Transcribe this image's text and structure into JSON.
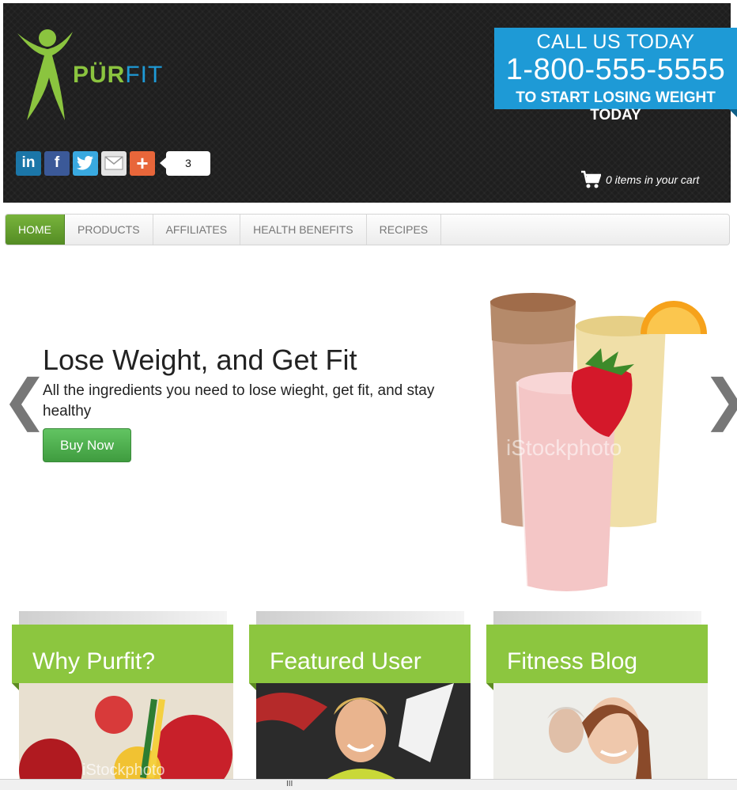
{
  "brand": {
    "pur": "PÜR",
    "fit": "FIT",
    "green": "#8bc43f",
    "blue": "#1e9ad6"
  },
  "callout": {
    "line1": "CALL US TODAY",
    "phone": "1-800-555-5555",
    "line3": "TO START LOSING WEIGHT TODAY"
  },
  "social": {
    "icons": [
      "linkedin-icon",
      "facebook-icon",
      "twitter-icon",
      "email-icon",
      "addthis-plus-icon"
    ],
    "linkedin": "in",
    "facebook": "f",
    "twitter": "t",
    "plus": "+",
    "share_count": "3"
  },
  "cart": {
    "text": "0 items in your cart"
  },
  "nav": {
    "items": [
      "HOME",
      "PRODUCTS",
      "AFFILIATES",
      "HEALTH BENEFITS",
      "RECIPES"
    ],
    "active": "HOME"
  },
  "hero": {
    "title": "Lose Weight, and Get Fit",
    "subtitle": "All the ingredients you need to lose wieght, get fit, and stay healthy",
    "button": "Buy Now",
    "prev": "❮",
    "next": "❯",
    "watermark": "iStockphoto"
  },
  "cards": [
    {
      "title": "Why Purfit?",
      "watermark": "iStockphoto"
    },
    {
      "title": "Featured User"
    },
    {
      "title": "Fitness Blog"
    }
  ],
  "statusbar": {
    "grip": "III"
  }
}
